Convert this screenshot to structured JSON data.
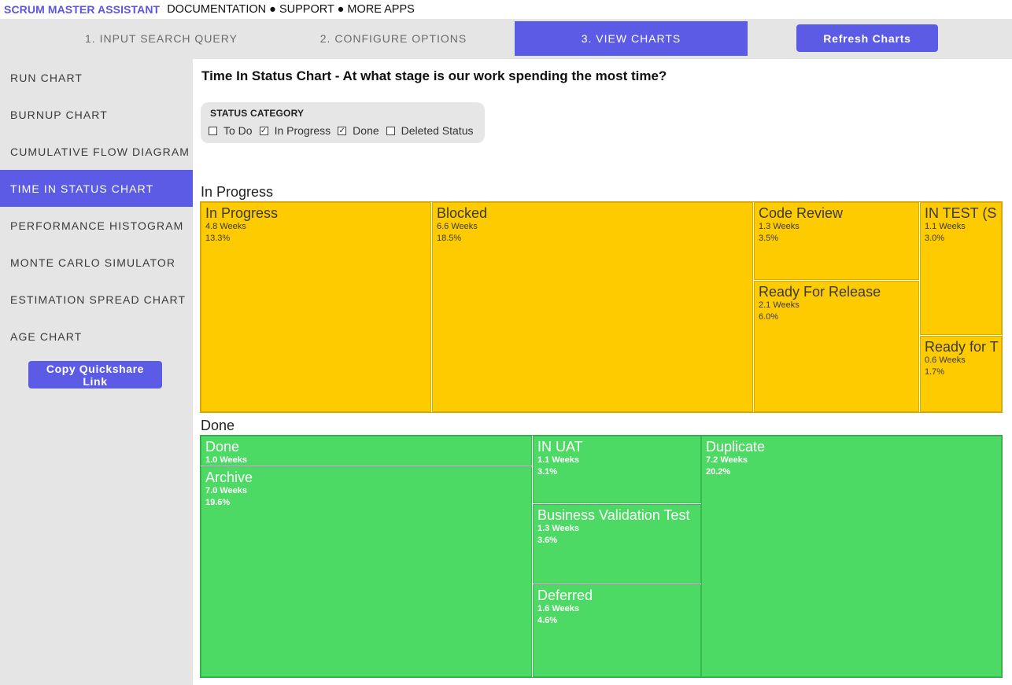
{
  "header": {
    "brand": "SCRUM MASTER ASSISTANT",
    "links": [
      "DOCUMENTATION",
      "SUPPORT",
      "MORE APPS"
    ],
    "separator": "●"
  },
  "steps": [
    {
      "label": "1. INPUT SEARCH QUERY"
    },
    {
      "label": "2. CONFIGURE OPTIONS"
    },
    {
      "label": "3. VIEW CHARTS"
    }
  ],
  "refresh_label": "Refresh Charts",
  "sidebar": {
    "items": [
      {
        "label": "RUN CHART"
      },
      {
        "label": "BURNUP CHART"
      },
      {
        "label": "CUMULATIVE FLOW DIAGRAM"
      },
      {
        "label": "TIME IN STATUS CHART"
      },
      {
        "label": "PERFORMANCE HISTOGRAM"
      },
      {
        "label": "MONTE CARLO SIMULATOR"
      },
      {
        "label": "ESTIMATION SPREAD CHART"
      },
      {
        "label": "AGE CHART"
      }
    ],
    "quickshare_label": "Copy Quickshare Link"
  },
  "main": {
    "title": "Time In Status Chart - At what stage is our work spending the most time?",
    "filter": {
      "title": "STATUS CATEGORY",
      "options": [
        {
          "label": "To Do",
          "checked": false
        },
        {
          "label": "In Progress",
          "checked": true
        },
        {
          "label": "Done",
          "checked": true
        },
        {
          "label": "Deleted Status",
          "checked": false
        }
      ]
    }
  },
  "chart_data": {
    "type": "treemap",
    "title": "",
    "groups": [
      {
        "name": "In Progress",
        "color": "#fecb00",
        "items": [
          {
            "name": "In Progress",
            "weeks": "4.8 Weeks",
            "percent": "13.3%",
            "value": 4.8
          },
          {
            "name": "Blocked",
            "weeks": "6.6 Weeks",
            "percent": "18.5%",
            "value": 6.6
          },
          {
            "name": "Code Review",
            "weeks": "1.3 Weeks",
            "percent": "3.5%",
            "value": 1.3
          },
          {
            "name": "Ready For Release",
            "weeks": "2.1 Weeks",
            "percent": "6.0%",
            "value": 2.1
          },
          {
            "name": "IN TEST (S",
            "weeks": "1.1 Weeks",
            "percent": "3.0%",
            "value": 1.1
          },
          {
            "name": "Ready for T",
            "weeks": "0.6 Weeks",
            "percent": "1.7%",
            "value": 0.6
          }
        ]
      },
      {
        "name": "Done",
        "color": "#4cd964",
        "items": [
          {
            "name": "Done",
            "weeks": "1.0 Weeks",
            "percent": "",
            "value": 1.0
          },
          {
            "name": "Archive",
            "weeks": "7.0 Weeks",
            "percent": "19.6%",
            "value": 7.0
          },
          {
            "name": "IN UAT",
            "weeks": "1.1 Weeks",
            "percent": "3.1%",
            "value": 1.1
          },
          {
            "name": "Business Validation Test",
            "weeks": "1.3 Weeks",
            "percent": "3.6%",
            "value": 1.3
          },
          {
            "name": "Deferred",
            "weeks": "1.6 Weeks",
            "percent": "4.6%",
            "value": 1.6
          },
          {
            "name": "Duplicate",
            "weeks": "7.2 Weeks",
            "percent": "20.2%",
            "value": 7.2
          }
        ]
      }
    ]
  }
}
